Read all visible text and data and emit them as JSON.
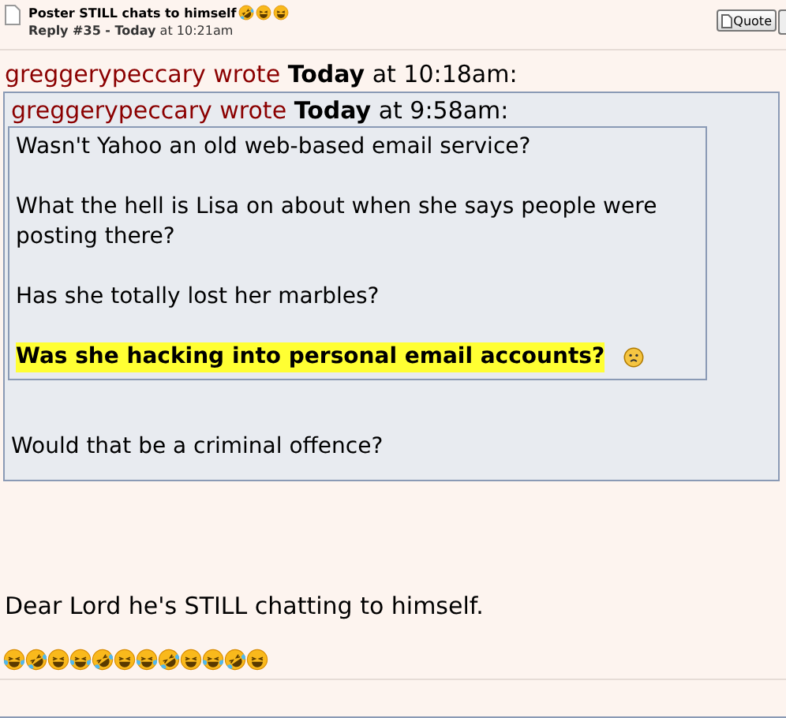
{
  "post": {
    "title": "Poster STILL chats to himself",
    "reply_number": "Reply #35 - ",
    "reply_day": "Today",
    "reply_time": " at 10:21am",
    "quote_button": "Quote"
  },
  "outer_quote": {
    "author": "greggerypeccary wrote",
    "day": "Today",
    "time": " at 10:18am:",
    "inner_quote": {
      "author": "greggerypeccary wrote",
      "day": "Today",
      "time": " at 9:58am:",
      "paragraphs": [
        {
          "text": "Wasn't Yahoo an old web-based email service?",
          "highlighted": false
        },
        {
          "text": "What the hell is Lisa on about when she says people were posting there?",
          "highlighted": false
        },
        {
          "text": "Has she totally lost her marbles?",
          "highlighted": false
        },
        {
          "text": "Was she hacking into personal email accounts?",
          "highlighted": true
        }
      ]
    },
    "reply": "Would that be a criminal offence?"
  },
  "message": "Dear Lord he's STILL chatting to himself."
}
